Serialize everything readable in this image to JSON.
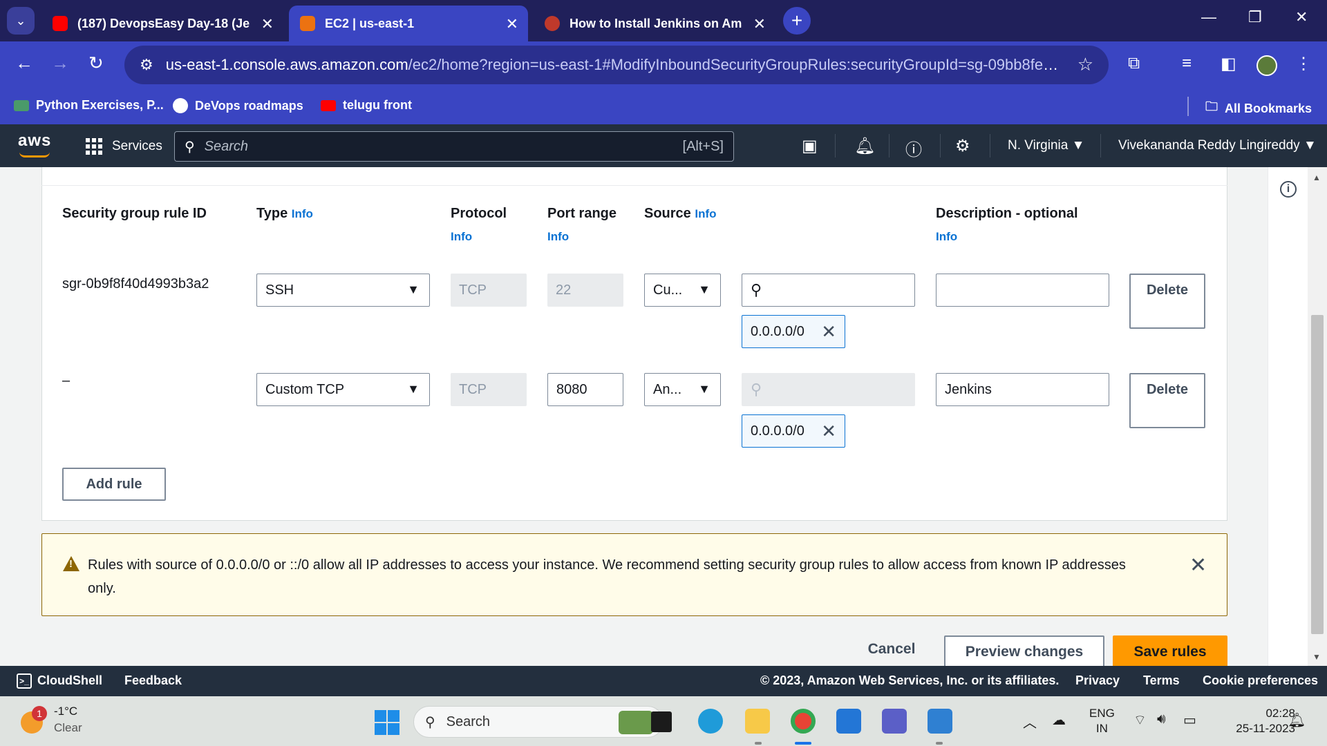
{
  "browser": {
    "tabs": [
      {
        "title": "(187) DevopsEasy Day-18 (Jenk",
        "favicon_color": "#ff0000",
        "active": false
      },
      {
        "title": "EC2 | us-east-1",
        "favicon_color": "#ec7211",
        "active": true
      },
      {
        "title": "How to Install Jenkins on Ama",
        "favicon_color": "#c0392b",
        "active": false
      }
    ],
    "url_host": "us-east-1.console.aws.amazon.com",
    "url_path": "/ec2/home?region=us-east-1#ModifyInboundSecurityGroupRules:securityGroupId=sg-09bb8fe0b3053e...",
    "bookmarks": [
      {
        "label": "Python Exercises, P...",
        "icon": "python-icon"
      },
      {
        "label": "DeVops roadmaps",
        "icon": "github-icon"
      },
      {
        "label": "telugu front",
        "icon": "youtube-icon"
      }
    ],
    "all_bookmarks": "All Bookmarks"
  },
  "aws": {
    "logo": "aws",
    "services": "Services",
    "search_placeholder": "Search",
    "search_shortcut": "[Alt+S]",
    "region": "N. Virginia",
    "user": "Vivekananda Reddy Lingireddy"
  },
  "table": {
    "headers": {
      "rule_id": "Security group rule ID",
      "type": "Type",
      "protocol": "Protocol",
      "port_range": "Port range",
      "source": "Source",
      "description": "Description - optional"
    },
    "info": "Info",
    "rows": [
      {
        "rule_id": "sgr-0b9f8f40d4993b3a2",
        "type": "SSH",
        "protocol": "TCP",
        "port": "22",
        "source_type": "Cu...",
        "search_value": "",
        "cidr": "0.0.0.0/0",
        "description": "",
        "delete": "Delete"
      },
      {
        "rule_id": "–",
        "type": "Custom TCP",
        "protocol": "TCP",
        "port": "8080",
        "source_type": "An...",
        "search_value": "",
        "cidr": "0.0.0.0/0",
        "description": "Jenkins",
        "delete": "Delete"
      }
    ],
    "add_rule": "Add rule"
  },
  "warning": {
    "text": "Rules with source of 0.0.0.0/0 or ::/0 allow all IP addresses to access your instance. We recommend setting security group rules to allow access from known IP addresses only."
  },
  "actions": {
    "cancel": "Cancel",
    "preview": "Preview changes",
    "save": "Save rules"
  },
  "footer": {
    "cloudshell": "CloudShell",
    "feedback": "Feedback",
    "copyright": "© 2023, Amazon Web Services, Inc. or its affiliates.",
    "privacy": "Privacy",
    "terms": "Terms",
    "cookies": "Cookie preferences"
  },
  "taskbar": {
    "weather_temp": "-1°C",
    "weather_desc": "Clear",
    "weather_badge": "1",
    "search": "Search",
    "lang_top": "ENG",
    "lang_bottom": "IN",
    "time": "02:28",
    "date": "25-11-2023"
  },
  "colors": {
    "aws_nav": "#232f3e",
    "aws_orange": "#ff9900",
    "link_blue": "#0972d3",
    "browser_accent": "#3a45c2"
  }
}
